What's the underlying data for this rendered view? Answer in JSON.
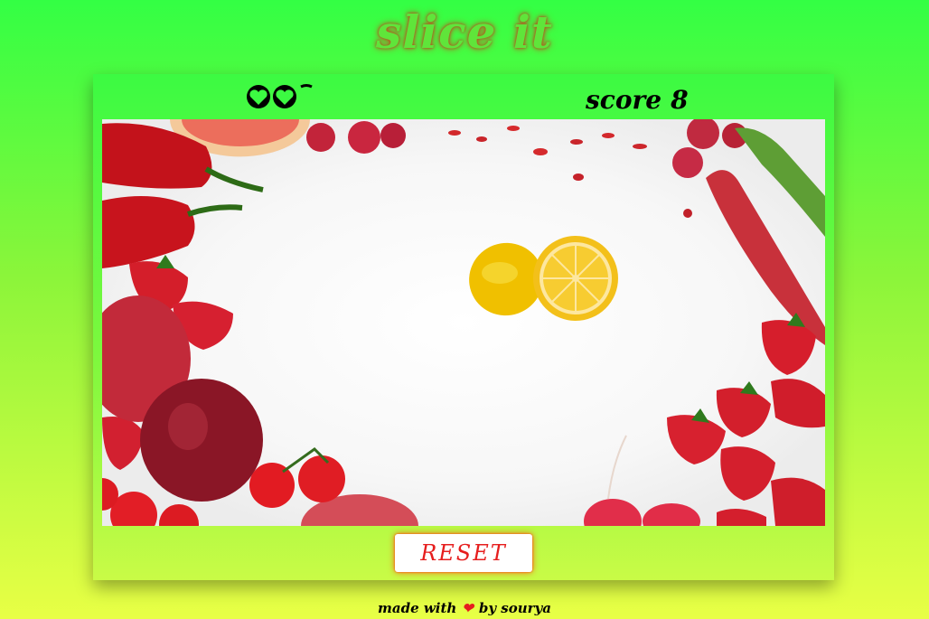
{
  "title": "slice it",
  "lives": {
    "count": 2,
    "icon": "heart-outline-icon"
  },
  "score": {
    "label": "score",
    "value": "8"
  },
  "board": {
    "background": "white table surrounded by red fruits and vegetables",
    "target_fruit": "lemon-sliced"
  },
  "reset_button": {
    "label": "RESET"
  },
  "footer": {
    "prefix": "made with",
    "icon": "heart-icon",
    "suffix": "by sourya"
  },
  "colors": {
    "accent": "#e61e1e",
    "panel": "#3cfa42",
    "title_glow": "#c84a1e"
  }
}
